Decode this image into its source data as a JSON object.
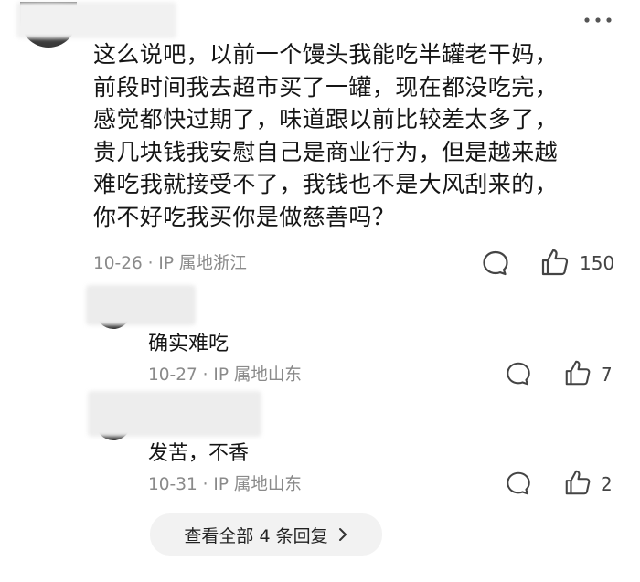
{
  "comment": {
    "lines": [
      "这么说吧，以前一个馒头我能吃半罐老干妈，",
      "前段时间我去超市买了一罐，现在都没吃完，",
      "感觉都快过期了，味道跟以前比较差太多了，",
      "贵几块钱我安慰自己是商业行为，但是越来越",
      "难吃我就接受不了，我钱也不是大风刮来的，",
      "你不好吃我买你是做慈善吗？"
    ],
    "date": "10-26",
    "location": "IP 属地浙江",
    "likes": "150"
  },
  "replies": [
    {
      "text": "确实难吃",
      "date": "10-27",
      "location": "IP 属地山东",
      "likes": "7"
    },
    {
      "text": "发苦，不香",
      "date": "10-31",
      "location": "IP 属地山东",
      "likes": "2"
    }
  ],
  "view_more": {
    "label": "查看全部 4 条回复",
    "icon": "chevron-right-icon"
  },
  "icons": {
    "more": "more-dots-icon",
    "reply": "comment-bubble-icon",
    "like": "thumbs-up-icon"
  }
}
